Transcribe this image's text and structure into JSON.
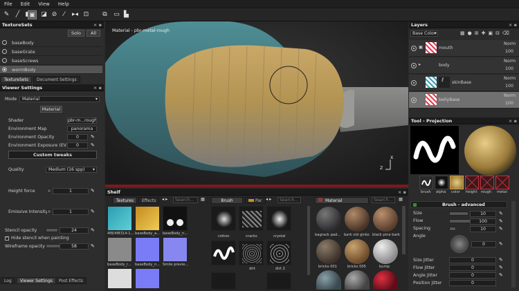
{
  "menu": [
    "File",
    "Edit",
    "View",
    "Help"
  ],
  "texturesets": {
    "title": "TextureSets",
    "solo": "Solo",
    "all": "All",
    "items": [
      "baseBody",
      "baseGrate",
      "baseScrews",
      "wormBody"
    ],
    "tabs": [
      "TextureSets",
      "Document Settings"
    ]
  },
  "viewer": {
    "title": "Viewer Settings",
    "mode_label": "Mode",
    "mode_value": "Material",
    "section": "Material",
    "shader_label": "Shader",
    "shader_value": "pbr-m...rough",
    "envmap_label": "Environment Map",
    "envmap_value": "panorama",
    "envop_label": "Environment Opacity",
    "envop_value": "0",
    "envexp_label": "Environment Exposure (EV)",
    "envexp_value": "0",
    "custom_tweaks": "Custom tweaks",
    "quality_label": "Quality",
    "quality_value": "Medium (16 spp)",
    "height_label": "Height force",
    "height_value": "1",
    "emissive_label": "Emissive Intensity",
    "emissive_value": "1",
    "stencil_label": "Stencil opacity",
    "stencil_value": "24",
    "hide_stencil": "Hide stencil when painting",
    "wire_label": "Wireframe opacity",
    "wire_value": "58",
    "bottom_tabs": [
      "Log",
      "Viewer Settings",
      "Post Effects"
    ]
  },
  "viewport": {
    "label": "Material - pbr-metal-rough",
    "axis_x": "X",
    "axis_z": "Z"
  },
  "shelf": {
    "title": "Shelf",
    "tabs1": [
      "Textures",
      "Effects"
    ],
    "search": "Search...",
    "tex": [
      "4f8/4f8314:1...",
      "baseBody_a...",
      "baseBody_n...",
      "baseBody_r...",
      "baseBody_n...",
      "Smile previe..."
    ],
    "brush_tab": "Brush",
    "par_tab": "Par",
    "brushes": [
      "cotton",
      "cracks",
      "crystal",
      "",
      "dirt",
      "dirt 2"
    ],
    "mat_tab": "Material",
    "materials": [
      "bagrack pad...",
      "bark old ginko",
      "black pine bark",
      "bricks 001",
      "bricks 005",
      "bump"
    ]
  },
  "layers": {
    "title": "Layers",
    "blend": "Base Color",
    "items": [
      {
        "name": "mouth",
        "mode": "Norm",
        "op": "100"
      },
      {
        "name": "body",
        "mode": "Norm",
        "op": "100"
      },
      {
        "name": "skinBase",
        "mode": "Norm",
        "op": "100"
      },
      {
        "name": "bellyBase",
        "mode": "Norm",
        "op": "100"
      }
    ]
  },
  "tool": {
    "title": "Tool - Projection",
    "chips": [
      "brush",
      "alpha",
      "color",
      "height",
      "rough",
      "metal"
    ],
    "section": "Brush - advanced",
    "size_label": "Size",
    "size_value": "10",
    "flow_label": "Flow",
    "flow_value": "100",
    "spacing_label": "Spacing",
    "spacing_value": "10",
    "angle_label": "Angle",
    "angle_value": "0",
    "sj_label": "Size Jitter",
    "sj_value": "0",
    "fj_label": "Flow Jitter",
    "fj_value": "0",
    "aj_label": "Angle Jitter",
    "aj_value": "0",
    "pj_label": "Position Jitter",
    "pj_value": "0"
  }
}
